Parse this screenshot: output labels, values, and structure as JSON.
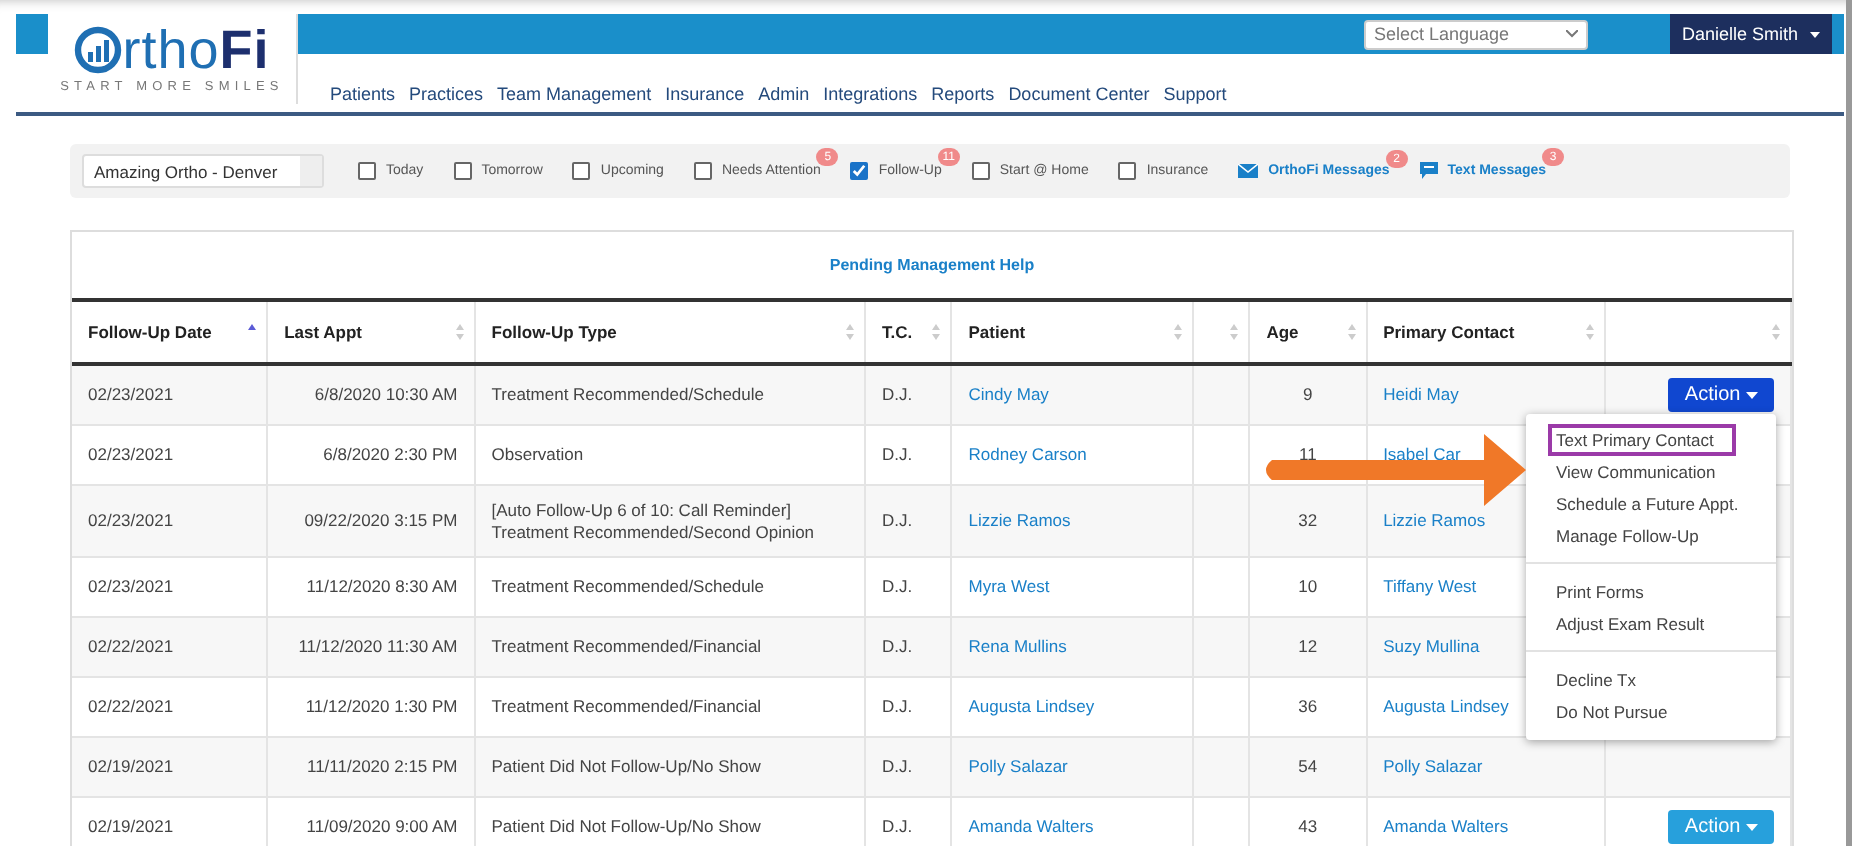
{
  "logo": {
    "name": "rtho**Fi**",
    "tagline": "START MORE SMILES"
  },
  "language_select": {
    "placeholder": "Select Language"
  },
  "user_menu": {
    "label": "Danielle Smith"
  },
  "nav": [
    "Patients",
    "Practices",
    "Team Management",
    "Insurance",
    "Admin",
    "Integrations",
    "Reports",
    "Document Center",
    "Support"
  ],
  "filters": {
    "practice": "Amazing Ortho - Denver",
    "items": [
      {
        "kind": "checkbox",
        "label": "Today",
        "checked": false
      },
      {
        "kind": "checkbox",
        "label": "Tomorrow",
        "checked": false
      },
      {
        "kind": "checkbox",
        "label": "Upcoming",
        "checked": false
      },
      {
        "kind": "checkbox",
        "label": "Needs Attention",
        "checked": false,
        "badge": "5"
      },
      {
        "kind": "checkbox",
        "label": "Follow-Up",
        "checked": true,
        "badge": "11"
      },
      {
        "kind": "checkbox",
        "label": "Start @ Home",
        "checked": false
      },
      {
        "kind": "checkbox",
        "label": "Insurance",
        "checked": false
      },
      {
        "kind": "mail",
        "label": "OrthoFi Messages",
        "badge": "2"
      },
      {
        "kind": "chat",
        "label": "Text Messages",
        "badge": "3"
      }
    ]
  },
  "table": {
    "title": "Pending Management Help",
    "columns": [
      {
        "label": "Follow-Up Date",
        "sorted": true
      },
      {
        "label": "Last Appt",
        "sorted": false
      },
      {
        "label": "Follow-Up Type",
        "sorted": false
      },
      {
        "label": "T.C.",
        "sorted": false
      },
      {
        "label": "Patient",
        "sorted": false
      },
      {
        "sorted": false
      },
      {
        "label": "Age",
        "sorted": false
      },
      {
        "label": "Primary Contact",
        "sorted": false
      },
      {
        "sorted": false
      }
    ],
    "rows": [
      {
        "date": "02/23/2021",
        "last_appt": "6/8/2020 10:30 AM",
        "type": [
          "Treatment Recommended/Schedule"
        ],
        "tc": "D.J.",
        "patient": "Cindy May",
        "age": "9",
        "contact": "Heidi May",
        "action": {
          "label": "Action",
          "open": true
        }
      },
      {
        "date": "02/23/2021",
        "last_appt": "6/8/2020 2:30 PM",
        "type": [
          "Observation"
        ],
        "tc": "D.J.",
        "patient": "Rodney Carson",
        "age": "11",
        "contact": "Isabel Car"
      },
      {
        "date": "02/23/2021",
        "last_appt": "09/22/2020 3:15 PM",
        "type": [
          "[Auto Follow-Up 6 of 10: Call Reminder]",
          "Treatment Recommended/Second Opinion"
        ],
        "tc": "D.J.",
        "patient": "Lizzie Ramos",
        "age": "32",
        "contact": "Lizzie Ramos"
      },
      {
        "date": "02/23/2021",
        "last_appt": "11/12/2020 8:30 AM",
        "type": [
          "Treatment Recommended/Schedule"
        ],
        "tc": "D.J.",
        "patient": "Myra West",
        "age": "10",
        "contact": "Tiffany West"
      },
      {
        "date": "02/22/2021",
        "last_appt": "11/12/2020 11:30 AM",
        "type": [
          "Treatment Recommended/Financial"
        ],
        "tc": "D.J.",
        "patient": "Rena Mullins",
        "age": "12",
        "contact": "Suzy Mullina"
      },
      {
        "date": "02/22/2021",
        "last_appt": "11/12/2020 1:30 PM",
        "type": [
          "Treatment Recommended/Financial"
        ],
        "tc": "D.J.",
        "patient": "Augusta Lindsey",
        "age": "36",
        "contact": "Augusta Lindsey"
      },
      {
        "date": "02/19/2021",
        "last_appt": "11/11/2020 2:15 PM",
        "type": [
          "Patient Did Not Follow-Up/No Show"
        ],
        "tc": "D.J.",
        "patient": "Polly Salazar",
        "age": "54",
        "contact": "Polly Salazar"
      },
      {
        "date": "02/19/2021",
        "last_appt": "11/09/2020 9:00 AM",
        "type": [
          "Patient Did Not Follow-Up/No Show"
        ],
        "tc": "D.J.",
        "patient": "Amanda Walters",
        "age": "43",
        "contact": "Amanda Walters",
        "action": {
          "label": "Action",
          "open": false
        }
      }
    ]
  },
  "action_menu": {
    "groups": [
      [
        {
          "label": "Text Primary Contact",
          "highlighted": true
        },
        {
          "label": "View Communication",
          "highlighted": false
        },
        {
          "label": "Schedule a Future Appt.",
          "highlighted": false
        },
        {
          "label": "Manage Follow-Up",
          "highlighted": false
        }
      ],
      [
        {
          "label": "Print Forms",
          "highlighted": false
        },
        {
          "label": "Adjust Exam Result",
          "highlighted": false
        }
      ],
      [
        {
          "label": "Decline Tx",
          "highlighted": false
        },
        {
          "label": "Do Not Pursue",
          "highlighted": false
        }
      ]
    ]
  }
}
